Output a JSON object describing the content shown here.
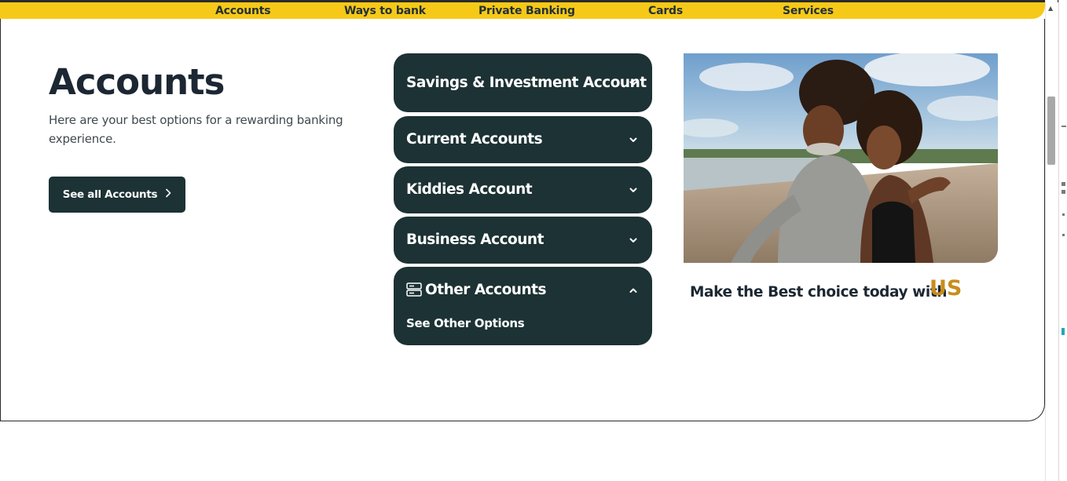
{
  "nav": {
    "items": [
      {
        "label": "Accounts"
      },
      {
        "label": "Ways to bank"
      },
      {
        "label": "Private Banking"
      },
      {
        "label": "Cards"
      },
      {
        "label": "Services"
      }
    ]
  },
  "hero": {
    "title": "Accounts",
    "description": "Here are your best options for a rewarding banking experience.",
    "button_label": "See all Accounts"
  },
  "accordion": {
    "items": [
      {
        "label": "Savings & Investment Account",
        "expanded": false
      },
      {
        "label": "Current Accounts",
        "expanded": false
      },
      {
        "label": "Kiddies Account",
        "expanded": false
      },
      {
        "label": "Business Account",
        "expanded": false
      },
      {
        "label": "Other Accounts",
        "expanded": true,
        "sub_label": "See Other Options"
      }
    ]
  },
  "promo": {
    "tagline": "Make the Best choice today with",
    "tagline_highlight": "US"
  },
  "colors": {
    "nav_yellow": "#f6c918",
    "dark_teal": "#1c3234",
    "accent_gold": "#c98d1c",
    "heading": "#1c2733"
  }
}
